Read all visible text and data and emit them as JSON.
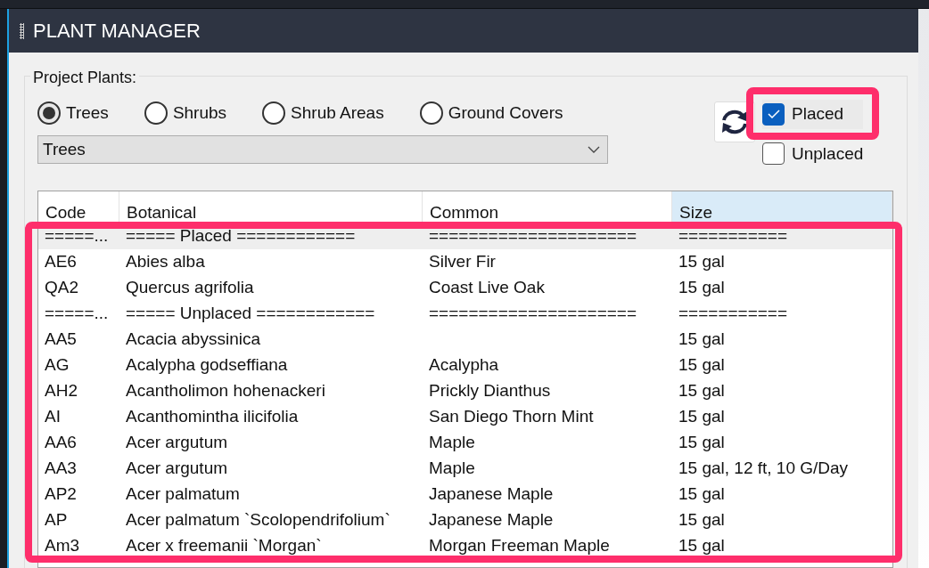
{
  "window": {
    "title": "PLANT MANAGER"
  },
  "group": {
    "label": "Project Plants:"
  },
  "categories": [
    {
      "label": "Trees",
      "selected": true
    },
    {
      "label": "Shrubs",
      "selected": false
    },
    {
      "label": "Shrub Areas",
      "selected": false
    },
    {
      "label": "Ground Covers",
      "selected": false
    }
  ],
  "dropdown": {
    "value": "Trees"
  },
  "filters": [
    {
      "label": "Placed",
      "checked": true,
      "highlighted": true
    },
    {
      "label": "Unplaced",
      "checked": false,
      "highlighted": false
    }
  ],
  "table": {
    "columns": [
      {
        "label": "Code",
        "sorted": false
      },
      {
        "label": "Botanical",
        "sorted": false
      },
      {
        "label": "Common",
        "sorted": false
      },
      {
        "label": "Size",
        "sorted": true
      }
    ],
    "rows": [
      {
        "selected": true,
        "cells": [
          "=====...",
          "===== Placed ============",
          "=====================",
          "==========="
        ]
      },
      {
        "selected": false,
        "cells": [
          "AE6",
          "Abies alba",
          "Silver Fir",
          "15 gal"
        ]
      },
      {
        "selected": false,
        "cells": [
          "QA2",
          "Quercus agrifolia",
          "Coast Live Oak",
          "15 gal"
        ]
      },
      {
        "selected": false,
        "cells": [
          "=====...",
          "===== Unplaced ============",
          "=====================",
          "==========="
        ]
      },
      {
        "selected": false,
        "cells": [
          "AA5",
          "Acacia abyssinica",
          "",
          "15 gal"
        ]
      },
      {
        "selected": false,
        "cells": [
          "AG",
          "Acalypha godseffiana",
          "Acalypha",
          "15 gal"
        ]
      },
      {
        "selected": false,
        "cells": [
          "AH2",
          "Acantholimon hohenackeri",
          "Prickly Dianthus",
          "15 gal"
        ]
      },
      {
        "selected": false,
        "cells": [
          "AI",
          "Acanthomintha ilicifolia",
          "San Diego Thorn Mint",
          "15 gal"
        ]
      },
      {
        "selected": false,
        "cells": [
          "AA6",
          "Acer argutum",
          "Maple",
          "15 gal"
        ]
      },
      {
        "selected": false,
        "cells": [
          "AA3",
          "Acer argutum",
          "Maple",
          "15 gal, 12 ft, 10 G/Day"
        ]
      },
      {
        "selected": false,
        "cells": [
          "AP2",
          "Acer palmatum",
          "Japanese Maple",
          "15 gal"
        ]
      },
      {
        "selected": false,
        "cells": [
          "AP",
          "Acer palmatum  `Scolopendrifolium`",
          "Japanese Maple",
          "15 gal"
        ]
      },
      {
        "selected": false,
        "cells": [
          "Am3",
          "Acer x freemanii `Morgan`",
          "Morgan Freeman Maple",
          "15 gal"
        ]
      }
    ]
  },
  "table_highlighted": true
}
